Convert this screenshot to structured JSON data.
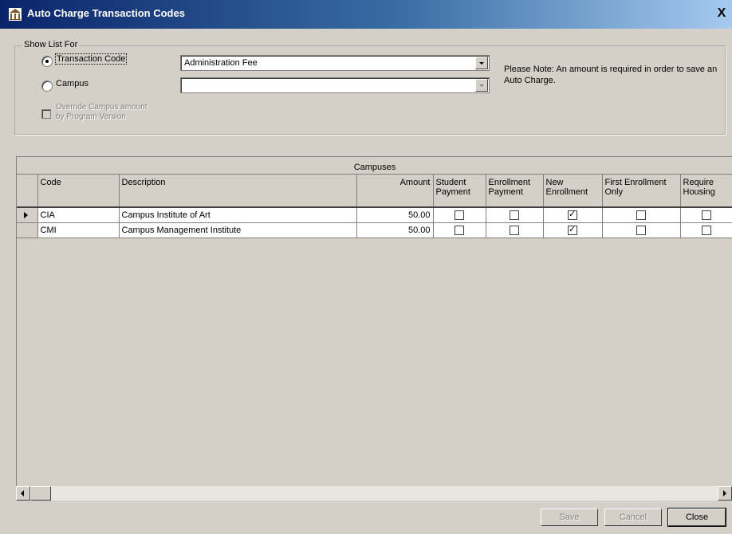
{
  "window": {
    "title": "Auto Charge Transaction Codes",
    "close_glyph": "X",
    "icon": "building-icon"
  },
  "filter": {
    "legend": "Show List For",
    "transaction_code_label": "Transaction Code",
    "transaction_code_value": "Administration Fee",
    "campus_label": "Campus",
    "campus_value": "",
    "override_label_line1": "Override Campus amount",
    "override_label_line2": "by Program Version"
  },
  "note": "Please Note: An amount is required in order to save an Auto Charge.",
  "grid": {
    "caption": "Campuses",
    "columns": {
      "code": "Code",
      "description": "Description",
      "amount": "Amount",
      "student_payment": [
        "Student",
        "Payment"
      ],
      "enrollment_payment": [
        "Enrollment",
        "Payment"
      ],
      "new_enrollment": [
        "New",
        "Enrollment"
      ],
      "first_enrollment_only": [
        "First Enrollment",
        "Only"
      ],
      "require_housing": [
        "Require",
        "Housing"
      ]
    },
    "rows": [
      {
        "code": "CIA",
        "description": "Campus Institute of Art",
        "amount": "50.00",
        "student_payment": false,
        "enrollment_payment": false,
        "new_enrollment": true,
        "first_enrollment_only": false,
        "require_housing": false
      },
      {
        "code": "CMI",
        "description": "Campus Management Institute",
        "amount": "50.00",
        "student_payment": false,
        "enrollment_payment": false,
        "new_enrollment": true,
        "first_enrollment_only": false,
        "require_housing": false
      }
    ]
  },
  "buttons": {
    "save": "Save",
    "cancel": "Cancel",
    "close": "Close"
  }
}
